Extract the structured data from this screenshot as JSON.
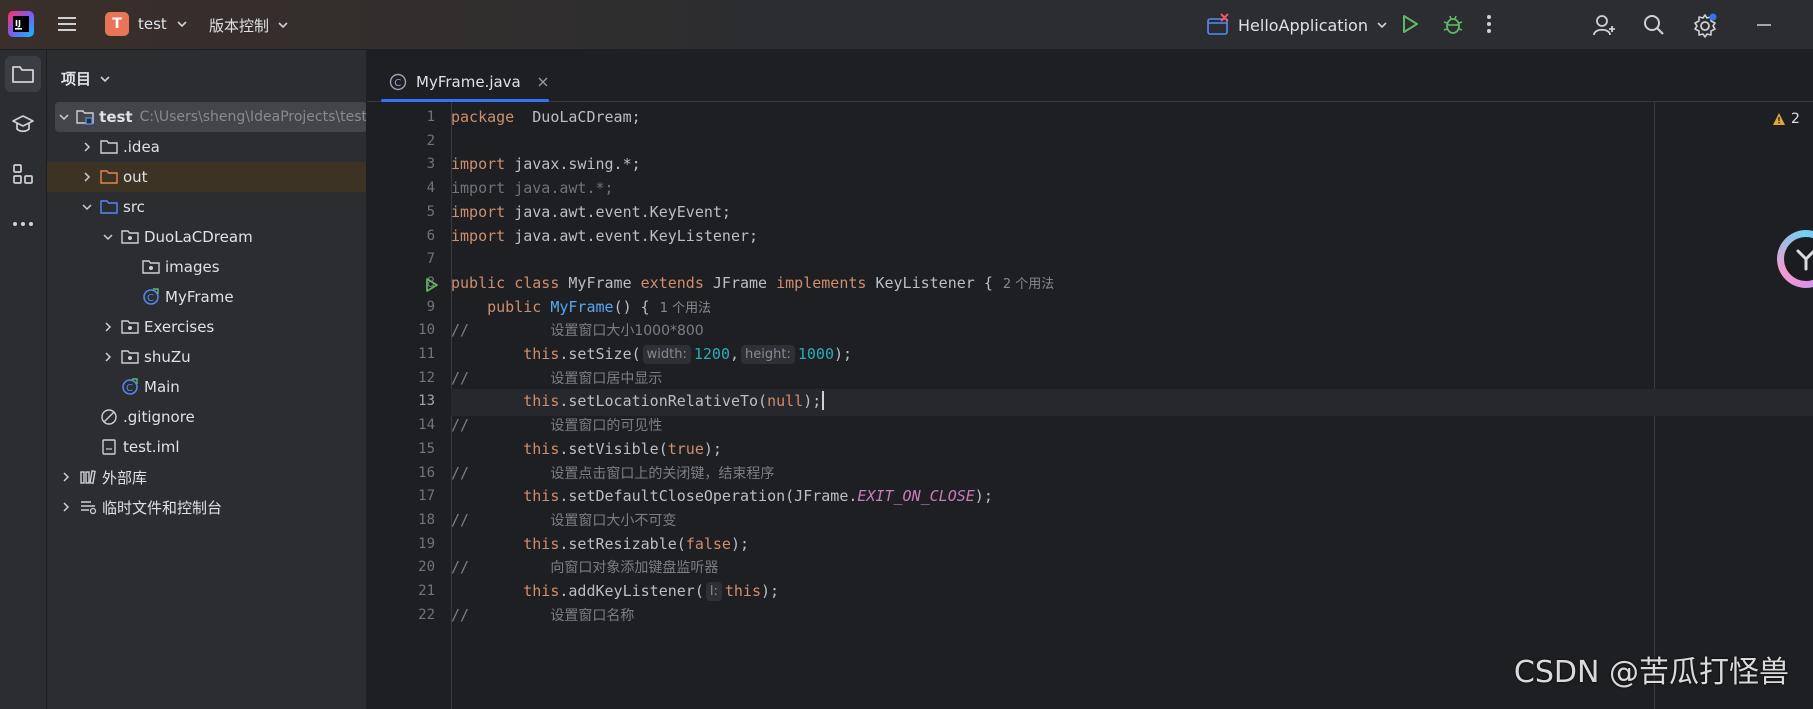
{
  "titlebar": {
    "project_initial": "T",
    "project_name": "test",
    "vcs_label": "版本控制",
    "run_config": "HelloApplication"
  },
  "colors": {
    "accent": "#3574f0",
    "project_badge": "#e8755a",
    "run_green": "#5fb865",
    "warning": "#e2a53a"
  },
  "project_panel": {
    "title": "项目",
    "tree": [
      {
        "label": "test",
        "path": "C:\\Users\\sheng\\IdeaProjects\\test",
        "level": 0,
        "expanded": true,
        "icon": "module-folder-icon",
        "selected": true
      },
      {
        "label": ".idea",
        "level": 1,
        "expanded": false,
        "icon": "folder-icon"
      },
      {
        "label": "out",
        "level": 1,
        "expanded": false,
        "icon": "excluded-folder-icon",
        "highlight": true
      },
      {
        "label": "src",
        "level": 1,
        "expanded": true,
        "icon": "source-folder-icon"
      },
      {
        "label": "DuoLaCDream",
        "level": 2,
        "expanded": true,
        "icon": "package-icon"
      },
      {
        "label": "images",
        "level": 3,
        "icon": "package-icon"
      },
      {
        "label": "MyFrame",
        "level": 3,
        "icon": "class-icon"
      },
      {
        "label": "Exercises",
        "level": 2,
        "expanded": false,
        "icon": "package-icon"
      },
      {
        "label": "shuZu",
        "level": 2,
        "expanded": false,
        "icon": "package-icon"
      },
      {
        "label": "Main",
        "level": 2,
        "icon": "class-icon"
      },
      {
        "label": ".gitignore",
        "level": 1,
        "icon": "ignore-file-icon"
      },
      {
        "label": "test.iml",
        "level": 1,
        "icon": "iml-file-icon"
      },
      {
        "label": "外部库",
        "level": 0,
        "expanded": false,
        "icon": "library-icon"
      },
      {
        "label": "临时文件和控制台",
        "level": 0,
        "expanded": false,
        "icon": "scratches-icon"
      }
    ]
  },
  "editor": {
    "tab_label": "MyFrame.java",
    "warning_count": "2",
    "current_line": 13,
    "lines": [
      {
        "n": "1",
        "segs": [
          [
            "kw",
            "package"
          ],
          [
            "",
            "  DuoLaCDream;"
          ]
        ]
      },
      {
        "n": "2",
        "segs": []
      },
      {
        "n": "3",
        "segs": [
          [
            "kw",
            "import"
          ],
          [
            "",
            " javax.swing.*;"
          ]
        ]
      },
      {
        "n": "4",
        "segs": [
          [
            "dim",
            "import java.awt.*;"
          ]
        ]
      },
      {
        "n": "5",
        "segs": [
          [
            "kw",
            "import"
          ],
          [
            "",
            " java.awt.event.KeyEvent;"
          ]
        ]
      },
      {
        "n": "6",
        "segs": [
          [
            "kw",
            "import"
          ],
          [
            "",
            " java.awt.event.KeyListener;"
          ]
        ]
      },
      {
        "n": "7",
        "segs": []
      },
      {
        "n": "8",
        "run": true,
        "segs": [
          [
            "kw",
            "public class"
          ],
          [
            "",
            " MyFrame "
          ],
          [
            "kw",
            "extends"
          ],
          [
            "",
            " JFrame "
          ],
          [
            "kw",
            "implements"
          ],
          [
            "",
            " KeyListener {"
          ],
          [
            "usage",
            "2 个用法"
          ]
        ]
      },
      {
        "n": "9",
        "segs": [
          [
            "",
            "    "
          ],
          [
            "kw",
            "public"
          ],
          [
            "",
            " "
          ],
          [
            "fn",
            "MyFrame"
          ],
          [
            "",
            "() {"
          ],
          [
            "usage",
            "1 个用法"
          ]
        ]
      },
      {
        "n": "10",
        "segs": [
          [
            "cm",
            "//         "
          ],
          [
            "cmzh",
            "设置窗口大小1000*800"
          ]
        ]
      },
      {
        "n": "11",
        "segs": [
          [
            "",
            "        "
          ],
          [
            "kw",
            "this"
          ],
          [
            "",
            ".setSize("
          ],
          [
            "hint",
            "width:"
          ],
          [
            "num",
            "1200"
          ],
          [
            "",
            ","
          ],
          [
            "hint",
            "height:"
          ],
          [
            "num",
            "1000"
          ],
          [
            "",
            ");"
          ]
        ]
      },
      {
        "n": "12",
        "segs": [
          [
            "cm",
            "//         "
          ],
          [
            "cmzh",
            "设置窗口居中显示"
          ]
        ]
      },
      {
        "n": "13",
        "segs": [
          [
            "",
            "        "
          ],
          [
            "kw",
            "this"
          ],
          [
            "",
            ".setLocationRelativeTo("
          ],
          [
            "kw",
            "null"
          ],
          [
            "",
            ");"
          ]
        ]
      },
      {
        "n": "14",
        "segs": [
          [
            "cm",
            "//         "
          ],
          [
            "cmzh",
            "设置窗口的可见性"
          ]
        ]
      },
      {
        "n": "15",
        "segs": [
          [
            "",
            "        "
          ],
          [
            "kw",
            "this"
          ],
          [
            "",
            ".setVisible("
          ],
          [
            "kw",
            "true"
          ],
          [
            "",
            ");"
          ]
        ]
      },
      {
        "n": "16",
        "segs": [
          [
            "cm",
            "//         "
          ],
          [
            "cmzh",
            "设置点击窗口上的关闭键，结束程序"
          ]
        ]
      },
      {
        "n": "17",
        "segs": [
          [
            "",
            "        "
          ],
          [
            "kw",
            "this"
          ],
          [
            "",
            ".setDefaultCloseOperation(JFrame."
          ],
          [
            "cn",
            "EXIT_ON_CLOSE"
          ],
          [
            "",
            ");"
          ]
        ]
      },
      {
        "n": "18",
        "segs": [
          [
            "cm",
            "//         "
          ],
          [
            "cmzh",
            "设置窗口大小不可变"
          ]
        ]
      },
      {
        "n": "19",
        "segs": [
          [
            "",
            "        "
          ],
          [
            "kw",
            "this"
          ],
          [
            "",
            ".setResizable("
          ],
          [
            "kw",
            "false"
          ],
          [
            "",
            ");"
          ]
        ]
      },
      {
        "n": "20",
        "segs": [
          [
            "cm",
            "//         "
          ],
          [
            "cmzh",
            "向窗口对象添加键盘监听器"
          ]
        ]
      },
      {
        "n": "21",
        "segs": [
          [
            "",
            "        "
          ],
          [
            "kw",
            "this"
          ],
          [
            "",
            ".addKeyListener("
          ],
          [
            "hint",
            "l:"
          ],
          [
            "kw",
            "this"
          ],
          [
            "",
            ");"
          ]
        ]
      },
      {
        "n": "22",
        "segs": [
          [
            "cm",
            "//         "
          ],
          [
            "cmzh",
            "设置窗口名称"
          ]
        ]
      }
    ]
  },
  "watermark": "CSDN @苦瓜打怪兽"
}
